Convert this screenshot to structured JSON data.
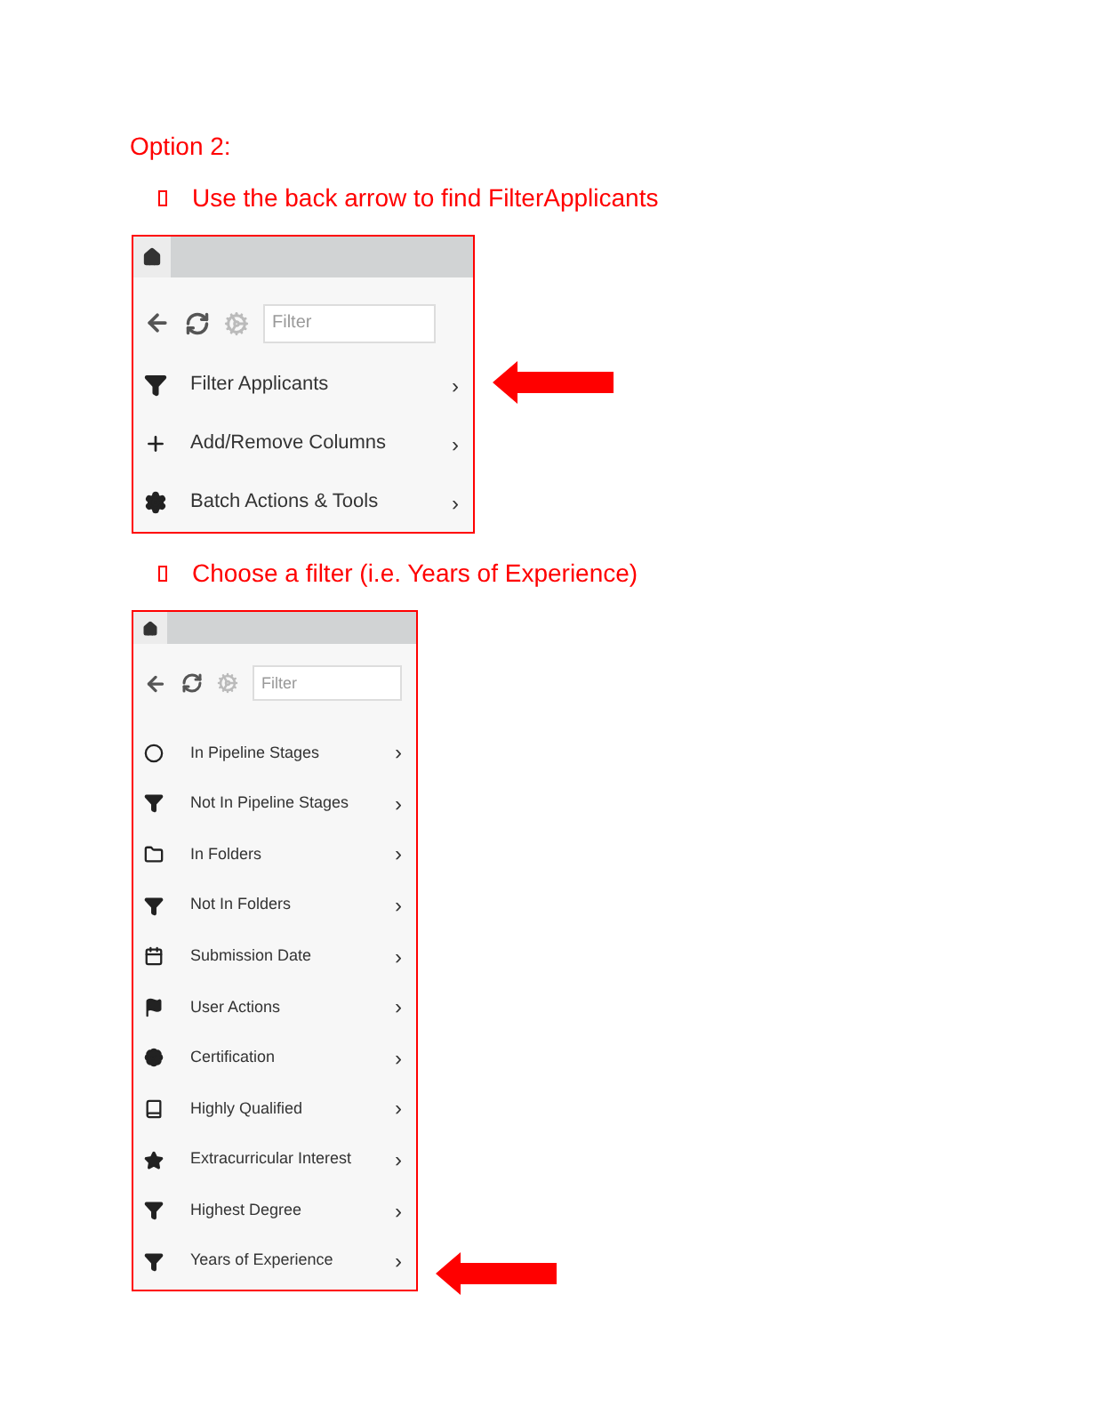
{
  "heading": "Option 2:",
  "steps": [
    {
      "text": "Use the back arrow to find FilterApplicants",
      "panel": {
        "filter_placeholder": "Filter",
        "items": [
          {
            "kind": "filter",
            "label": "Filter Applicants",
            "chevron": "›",
            "pointed": true
          },
          {
            "kind": "plus",
            "label": "Add/Remove Columns",
            "chevron": "›",
            "pointed": false
          },
          {
            "kind": "gear",
            "label": "Batch Actions & Tools",
            "chevron": "›",
            "pointed": false
          }
        ]
      }
    },
    {
      "text": "Choose a filter (i.e. Years of Experience)",
      "panel": {
        "filter_placeholder": "Filter",
        "items": [
          {
            "kind": "circle",
            "label": "In Pipeline Stages",
            "chevron": "›",
            "pointed": false
          },
          {
            "kind": "filter",
            "label": "Not In Pipeline Stages",
            "chevron": "›",
            "pointed": false
          },
          {
            "kind": "folder",
            "label": "In Folders",
            "chevron": "›",
            "pointed": false
          },
          {
            "kind": "filter",
            "label": "Not In Folders",
            "chevron": "›",
            "pointed": false
          },
          {
            "kind": "calendar",
            "label": "Submission Date",
            "chevron": "›",
            "pointed": false
          },
          {
            "kind": "flag",
            "label": "User Actions",
            "chevron": "›",
            "pointed": false
          },
          {
            "kind": "badge",
            "label": "Certification",
            "chevron": "›",
            "pointed": false
          },
          {
            "kind": "book",
            "label": "Highly Qualified",
            "chevron": "›",
            "pointed": false
          },
          {
            "kind": "star",
            "label": "Extracurricular Interest",
            "chevron": "›",
            "pointed": false
          },
          {
            "kind": "filter",
            "label": "Highest Degree",
            "chevron": "›",
            "pointed": false
          },
          {
            "kind": "filter",
            "label": "Years of Experience",
            "chevron": "›",
            "pointed": true
          }
        ]
      }
    }
  ]
}
